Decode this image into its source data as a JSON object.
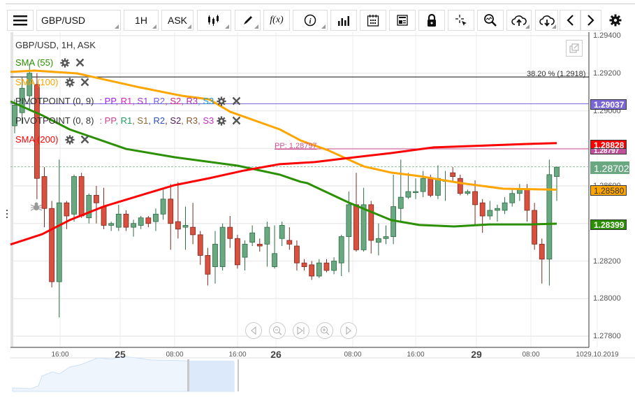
{
  "toolbar": {
    "symbol": "GBP/USD",
    "timeframe": "1H",
    "price_type": "ASK",
    "fx_label": "f(x)",
    "icons": [
      "menu-icon",
      "candlestick-icon",
      "pencil-icon",
      "function-icon",
      "info-icon",
      "bar-chart-icon",
      "calendar-icon",
      "news-icon",
      "lock-icon",
      "crosshair-icon",
      "zoom-icon",
      "cloud-upload-icon",
      "cloud-download-icon",
      "chevron-left-icon",
      "chevron-right-icon",
      "gear-icon"
    ]
  },
  "legend": {
    "title": "GBP/USD, 1H, ASK",
    "sma55": "SMA (55)",
    "sma100": "SMA (100)",
    "pivot9": "PIVOTPOINT (0, 9)",
    "pivot9_items": [
      {
        "t": ": PP",
        "c": "#a020f0"
      },
      {
        "t": ", R1",
        "c": "#e020c0"
      },
      {
        "t": ", S1",
        "c": "#a030d0"
      },
      {
        "t": ", R2",
        "c": "#7060e0"
      },
      {
        "t": ", S2",
        "c": "#d02080"
      },
      {
        "t": ", R3",
        "c": "#b030b0"
      },
      {
        "t": ", S3",
        "c": "#1a9ad0"
      }
    ],
    "pivot8": "PIVOTPOINT (0, 8)",
    "pivot8_items": [
      {
        "t": ": PP",
        "c": "#d04090"
      },
      {
        "t": ", R1",
        "c": "#20a060"
      },
      {
        "t": ", S1",
        "c": "#8a6a30"
      },
      {
        "t": ", R2",
        "c": "#3050b0"
      },
      {
        "t": ", S2",
        "c": "#502050"
      },
      {
        "t": ", R3",
        "c": "#8a5a30"
      },
      {
        "t": ", S3",
        "c": "#c030c0"
      }
    ],
    "sma200": "SMA (200)"
  },
  "colors": {
    "sma55": "#2a9000",
    "sma100": "#ffa500",
    "sma200": "#ff0000",
    "bull": "#6aa882",
    "bear": "#d9503f",
    "pivot9": "#7b68d6",
    "pivot8": "#d05090",
    "last": "#6aa882"
  },
  "annotations": {
    "fib": "38.20 % (1.2918)",
    "pp": "PP: 1.28797"
  },
  "price_tags": {
    "pivot9": "1.29037",
    "sma200": "1.28828",
    "pp": "1.28797",
    "last": "1.28702",
    "sma100": "1.28580",
    "sma55": "1.28399"
  },
  "chart_data": {
    "type": "candlestick",
    "symbol": "GBP/USD",
    "interval": "1H",
    "ylim": [
      1.2775,
      1.2945
    ],
    "y_ticks": [
      "1.29400",
      "1.29200",
      "1.29000",
      "1.28800",
      "1.28600",
      "1.28400",
      "1.28200",
      "1.28000",
      "1.27800"
    ],
    "x_ticks": [
      "16:00",
      "25",
      "08:00",
      "16:00",
      "26",
      "08:00",
      "16:00",
      "29",
      "08:00",
      "1029.10.2019"
    ],
    "hlines": {
      "fib_38_2": 1.2918,
      "pivot9_pp": 1.29037,
      "pivot8_pp": 1.28797,
      "last": 1.28702
    },
    "candles": [
      [
        1.2892,
        1.2906,
        1.2888,
        1.2903
      ],
      [
        1.2899,
        1.2918,
        1.2893,
        1.2912
      ],
      [
        1.2908,
        1.2925,
        1.29,
        1.292
      ],
      [
        1.2914,
        1.292,
        1.2853,
        1.2864
      ],
      [
        1.2865,
        1.287,
        1.2838,
        1.2848
      ],
      [
        1.2848,
        1.2852,
        1.2806,
        1.2809
      ],
      [
        1.2809,
        1.2874,
        1.279,
        1.2851
      ],
      [
        1.2851,
        1.2852,
        1.2837,
        1.2844
      ],
      [
        1.2845,
        1.2866,
        1.2841,
        1.2865
      ],
      [
        1.2865,
        1.2867,
        1.2843,
        1.2844
      ],
      [
        1.2843,
        1.2856,
        1.284,
        1.2855
      ],
      [
        1.2855,
        1.286,
        1.284,
        1.2851
      ],
      [
        1.2849,
        1.2859,
        1.2837,
        1.2839
      ],
      [
        1.2839,
        1.2841,
        1.2836,
        1.284
      ],
      [
        1.2838,
        1.285,
        1.2836,
        1.2845
      ],
      [
        1.2845,
        1.2847,
        1.2836,
        1.2838
      ],
      [
        1.2838,
        1.2842,
        1.2833,
        1.284
      ],
      [
        1.2839,
        1.2844,
        1.2837,
        1.2843
      ],
      [
        1.2843,
        1.2844,
        1.2838,
        1.284
      ],
      [
        1.2841,
        1.2848,
        1.2836,
        1.2845
      ],
      [
        1.2845,
        1.2858,
        1.2842,
        1.2853
      ],
      [
        1.2853,
        1.2861,
        1.2826,
        1.284
      ],
      [
        1.2841,
        1.2862,
        1.2832,
        1.2837
      ],
      [
        1.2838,
        1.2849,
        1.2826,
        1.2839
      ],
      [
        1.2838,
        1.2851,
        1.2829,
        1.2834
      ],
      [
        1.2834,
        1.2836,
        1.2818,
        1.2823
      ],
      [
        1.2823,
        1.2827,
        1.2807,
        1.2813
      ],
      [
        1.2817,
        1.2836,
        1.2808,
        1.2829
      ],
      [
        1.2817,
        1.284,
        1.2815,
        1.2838
      ],
      [
        1.2838,
        1.2844,
        1.2827,
        1.2832
      ],
      [
        1.2832,
        1.2834,
        1.2816,
        1.2818
      ],
      [
        1.2822,
        1.2831,
        1.2815,
        1.2829
      ],
      [
        1.283,
        1.2839,
        1.2828,
        1.2835
      ],
      [
        1.2829,
        1.2832,
        1.2825,
        1.2828
      ],
      [
        1.2829,
        1.2841,
        1.2817,
        1.2838
      ],
      [
        1.2817,
        1.2839,
        1.2816,
        1.2824
      ],
      [
        1.2832,
        1.2841,
        1.2828,
        1.2839
      ],
      [
        1.2831,
        1.2838,
        1.2826,
        1.2829
      ],
      [
        1.2828,
        1.2831,
        1.2815,
        1.2819
      ],
      [
        1.2819,
        1.2821,
        1.2815,
        1.2817
      ],
      [
        1.2818,
        1.282,
        1.281,
        1.2812
      ],
      [
        1.2812,
        1.2821,
        1.2811,
        1.2819
      ],
      [
        1.2819,
        1.2821,
        1.2814,
        1.2815
      ],
      [
        1.2815,
        1.2822,
        1.2813,
        1.282
      ],
      [
        1.2819,
        1.2834,
        1.2812,
        1.2833
      ],
      [
        1.2833,
        1.2857,
        1.2814,
        1.285
      ],
      [
        1.285,
        1.2867,
        1.2825,
        1.2826
      ],
      [
        1.2826,
        1.2859,
        1.2825,
        1.285
      ],
      [
        1.285,
        1.2852,
        1.2824,
        1.2831
      ],
      [
        1.283,
        1.284,
        1.2823,
        1.2832
      ],
      [
        1.2832,
        1.2839,
        1.2829,
        1.2833
      ],
      [
        1.2833,
        1.2866,
        1.2829,
        1.2849
      ],
      [
        1.2848,
        1.2874,
        1.2841,
        1.2854
      ],
      [
        1.2854,
        1.2867,
        1.2853,
        1.2857
      ],
      [
        1.2857,
        1.2864,
        1.2853,
        1.2857
      ],
      [
        1.2857,
        1.2868,
        1.2854,
        1.2864
      ],
      [
        1.2864,
        1.2866,
        1.2854,
        1.2855
      ],
      [
        1.2855,
        1.2871,
        1.2853,
        1.2864
      ],
      [
        1.2863,
        1.2868,
        1.2852,
        1.2863
      ],
      [
        1.2867,
        1.287,
        1.2862,
        1.2865
      ],
      [
        1.2864,
        1.2866,
        1.2855,
        1.2856
      ],
      [
        1.2856,
        1.2858,
        1.2855,
        1.2857
      ],
      [
        1.2857,
        1.2863,
        1.2839,
        1.285
      ],
      [
        1.2851,
        1.2853,
        1.2835,
        1.2844
      ],
      [
        1.2844,
        1.2852,
        1.2842,
        1.2847
      ],
      [
        1.2847,
        1.285,
        1.2841,
        1.2848
      ],
      [
        1.2847,
        1.2854,
        1.2845,
        1.2851
      ],
      [
        1.2851,
        1.2858,
        1.2849,
        1.2856
      ],
      [
        1.2856,
        1.2861,
        1.2852,
        1.2858
      ],
      [
        1.2858,
        1.2861,
        1.2841,
        1.2847
      ],
      [
        1.2847,
        1.2851,
        1.2826,
        1.2829
      ],
      [
        1.2829,
        1.2832,
        1.2808,
        1.2821
      ],
      [
        1.2821,
        1.2874,
        1.2807,
        1.2866
      ],
      [
        1.2865,
        1.287,
        1.2852,
        1.287
      ]
    ],
    "series": [
      {
        "name": "SMA (55)",
        "points": [
          [
            0,
            1.2905
          ],
          [
            3.7,
            1.28976
          ],
          [
            7.4,
            1.28901
          ],
          [
            15,
            1.28797
          ],
          [
            21.5,
            1.28753
          ],
          [
            30,
            1.28708
          ],
          [
            35.7,
            1.2866
          ],
          [
            38.5,
            1.28622
          ],
          [
            39.4,
            1.28615
          ],
          [
            45,
            1.28511
          ],
          [
            50.7,
            1.28418
          ],
          [
            54.5,
            1.28392
          ],
          [
            59.2,
            1.28384
          ],
          [
            63.9,
            1.28395
          ],
          [
            69.5,
            1.28395
          ],
          [
            73,
            1.28399
          ]
        ]
      },
      {
        "name": "SMA (100)",
        "points": [
          [
            0,
            1.29207
          ],
          [
            2.7,
            1.29214
          ],
          [
            8.4,
            1.29199
          ],
          [
            16.8,
            1.29125
          ],
          [
            22.5,
            1.2908
          ],
          [
            26.2,
            1.29061
          ],
          [
            29,
            1.28995
          ],
          [
            35.7,
            1.28901
          ],
          [
            38.5,
            1.28842
          ],
          [
            42.2,
            1.2879
          ],
          [
            47,
            1.28704
          ],
          [
            50.7,
            1.28671
          ],
          [
            54.5,
            1.28652
          ],
          [
            60.1,
            1.28615
          ],
          [
            65.8,
            1.28585
          ],
          [
            73,
            1.2858
          ]
        ]
      },
      {
        "name": "SMA (200)",
        "points": [
          [
            0,
            1.28288
          ],
          [
            3.7,
            1.28343
          ],
          [
            7.4,
            1.28418
          ],
          [
            12.1,
            1.28492
          ],
          [
            16.8,
            1.28548
          ],
          [
            21.5,
            1.28604
          ],
          [
            26.2,
            1.28641
          ],
          [
            30.9,
            1.28682
          ],
          [
            35.7,
            1.28716
          ],
          [
            40.4,
            1.28727
          ],
          [
            45,
            1.28749
          ],
          [
            50.7,
            1.28775
          ],
          [
            56.4,
            1.28805
          ],
          [
            63.9,
            1.28816
          ],
          [
            68.6,
            1.28823
          ],
          [
            73,
            1.28828
          ]
        ]
      }
    ]
  }
}
